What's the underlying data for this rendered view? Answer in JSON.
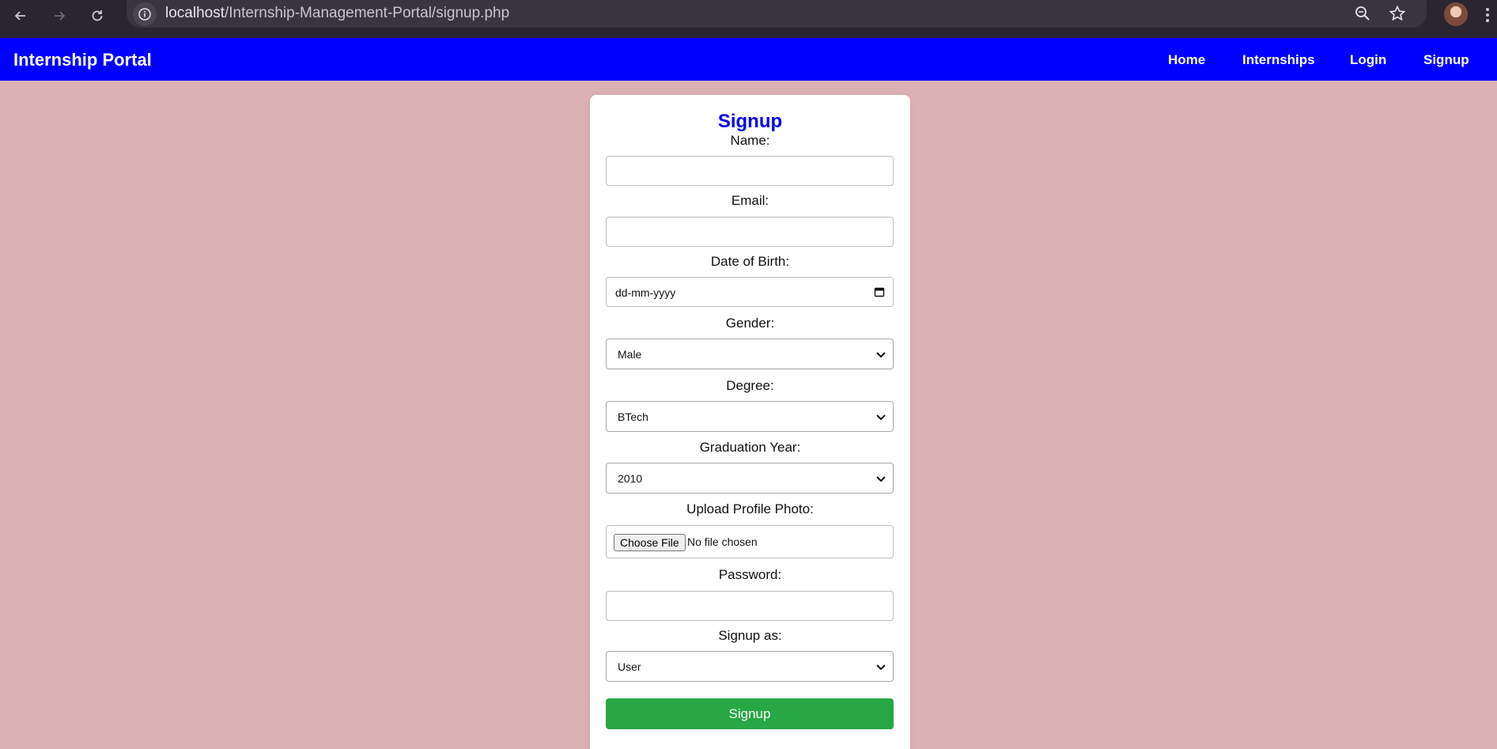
{
  "browser": {
    "url_host": "localhost",
    "url_path": "/Internship-Management-Portal/signup.php"
  },
  "site": {
    "brand": "Internship Portal",
    "nav": [
      "Home",
      "Internships",
      "Login",
      "Signup"
    ]
  },
  "form": {
    "title": "Signup",
    "name_label": "Name:",
    "name_value": "",
    "email_label": "Email:",
    "email_value": "",
    "dob_label": "Date of Birth:",
    "dob_placeholder": "dd-mm-yyyy",
    "gender_label": "Gender:",
    "gender_value": "Male",
    "degree_label": "Degree:",
    "degree_value": "BTech",
    "grad_label": "Graduation Year:",
    "grad_value": "2010",
    "photo_label": "Upload Profile Photo:",
    "choose_file": "Choose File",
    "no_file": "No file chosen",
    "password_label": "Password:",
    "password_value": "",
    "role_label": "Signup as:",
    "role_value": "User",
    "submit_label": "Signup"
  },
  "colors": {
    "page_bg": "#dcb1b3",
    "header_bg": "#0000ff",
    "title": "#0000ee",
    "submit_bg": "#28a745"
  }
}
